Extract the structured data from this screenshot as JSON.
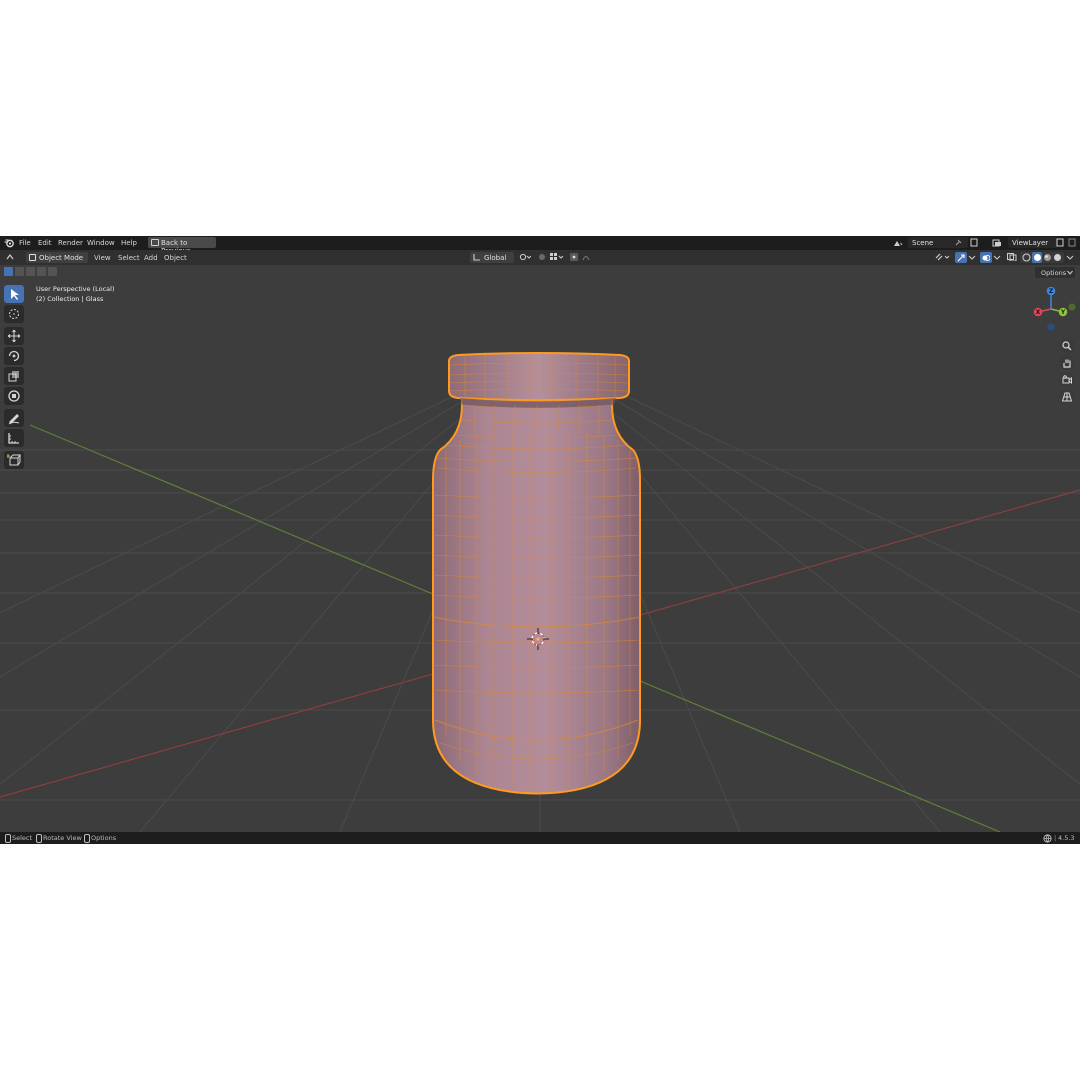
{
  "menu": {
    "items": [
      "File",
      "Edit",
      "Render",
      "Window",
      "Help"
    ],
    "back_button": "Back to Previous",
    "scene": "Scene",
    "view_layer": "ViewLayer"
  },
  "header": {
    "mode": "Object Mode",
    "menus": [
      "View",
      "Select",
      "Add",
      "Object"
    ],
    "transform_orientation": "Global"
  },
  "viewport": {
    "perspective": "User Perspective (Local)",
    "collection": "(2) Collection | Glass",
    "options_label": "Options",
    "gizmo_axes": [
      "Z",
      "Y",
      "X"
    ]
  },
  "status": {
    "hints": [
      "Select",
      "Rotate View",
      "Options"
    ],
    "version": "4.5.3"
  },
  "colors": {
    "viewport_bg": "#3d3d3d",
    "grid": "#4b4b4b",
    "x_axis": "#8c3e3e",
    "y_axis": "#5f7f3a",
    "object_fill": "#a9818e",
    "selection_outline": "#ff9a1f",
    "wire": "#e08a2a",
    "active_tool": "#4772b3"
  }
}
